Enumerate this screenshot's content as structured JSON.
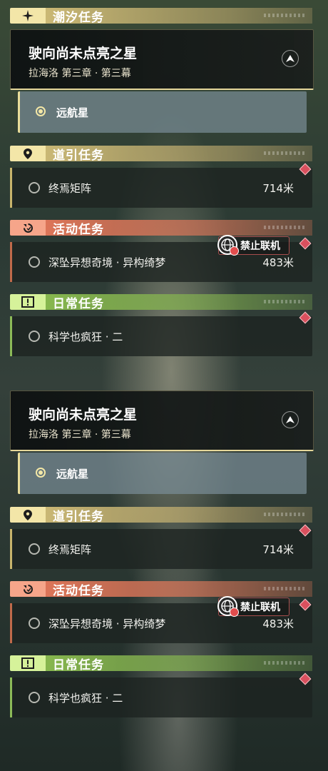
{
  "top_header": {
    "label": "潮汐任务"
  },
  "panels": [
    {
      "main_quest": {
        "title": "驶向尚未点亮之星",
        "subtitle": "拉海洛 第三章 · 第三幕"
      },
      "selected_task": {
        "label": "远航星"
      },
      "sections": {
        "guide": {
          "header": "道引任务",
          "task": "终焉矩阵",
          "distance": "714米"
        },
        "activity": {
          "header": "活动任务",
          "task": "深坠异想奇境 · 异构绮梦",
          "distance": "483米",
          "badge": "禁止联机"
        },
        "daily": {
          "header": "日常任务",
          "task": "科学也疯狂 · 二"
        }
      }
    },
    {
      "main_quest": {
        "title": "驶向尚未点亮之星",
        "subtitle": "拉海洛 第三章 · 第三幕"
      },
      "selected_task": {
        "label": "远航星"
      },
      "sections": {
        "guide": {
          "header": "道引任务",
          "task": "终焉矩阵",
          "distance": "714米"
        },
        "activity": {
          "header": "活动任务",
          "task": "深坠异想奇境 · 异构绮梦",
          "distance": "483米",
          "badge": "禁止联机"
        },
        "daily": {
          "header": "日常任务",
          "task": "科学也疯狂 · 二"
        }
      }
    }
  ],
  "colors": {
    "guide": "#f3e6a8",
    "activity": "#f6a58a",
    "daily": "#d6f29a",
    "marker": "#d9505e"
  },
  "icons": [
    "sparkle-icon",
    "navigate-icon",
    "location-pin-icon",
    "refresh-icon",
    "exclamation-icon",
    "no-multiplayer-icon",
    "diamond-marker-icon"
  ]
}
